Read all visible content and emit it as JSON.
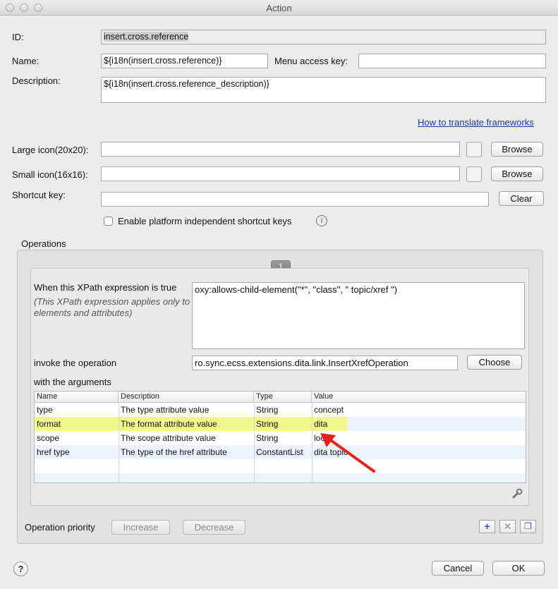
{
  "window": {
    "title": "Action"
  },
  "form": {
    "id_label": "ID:",
    "id_value": "insert.cross.reference",
    "name_label": "Name:",
    "name_value": "${i18n(insert.cross.reference)}",
    "menu_access_key_label": "Menu access key:",
    "menu_access_key_value": "",
    "description_label": "Description:",
    "description_value": "${i18n(insert.cross.reference_description)}",
    "translate_link": "How to translate frameworks",
    "large_icon_label": "Large icon(20x20):",
    "large_icon_value": "",
    "small_icon_label": "Small icon(16x16):",
    "small_icon_value": "",
    "browse_label": "Browse",
    "shortcut_label": "Shortcut key:",
    "shortcut_value": "",
    "clear_label": "Clear",
    "platform_checkbox_label": "Enable platform independent shortcut keys",
    "platform_checkbox_checked": false
  },
  "operations": {
    "group_label": "Operations",
    "page_number": "1",
    "xpath_label": "When this XPath expression is true",
    "xpath_hint": "(This XPath expression applies only to elements and attributes)",
    "xpath_value": "oxy:allows-child-element(\"*\", \"class\", \" topic/xref \")",
    "invoke_label": "invoke the operation",
    "invoke_value": "ro.sync.ecss.extensions.dita.link.InsertXrefOperation",
    "choose_label": "Choose",
    "arguments_label": "with the arguments",
    "columns": [
      "Name",
      "Description",
      "Type",
      "Value"
    ],
    "rows": [
      {
        "name": "type",
        "description": "The type attribute value",
        "type": "String",
        "value": "concept"
      },
      {
        "name": "format",
        "description": "The format attribute value",
        "type": "String",
        "value": "dita"
      },
      {
        "name": "scope",
        "description": "The scope attribute value",
        "type": "String",
        "value": "local"
      },
      {
        "name": "href type",
        "description": "The type of the href attribute",
        "type": "ConstantList",
        "value": "dita topic"
      }
    ],
    "highlight_color": "#f4f78a",
    "annotation_arrow_color": "#e8211d",
    "wrench_icon": "wrench-icon",
    "priority_label": "Operation priority",
    "increase_label": "Increase",
    "decrease_label": "Decrease",
    "add_icon": "plus-icon",
    "remove_icon": "x-icon",
    "duplicate_icon": "copy-icon"
  },
  "footer": {
    "help_label": "?",
    "cancel_label": "Cancel",
    "ok_label": "OK"
  }
}
